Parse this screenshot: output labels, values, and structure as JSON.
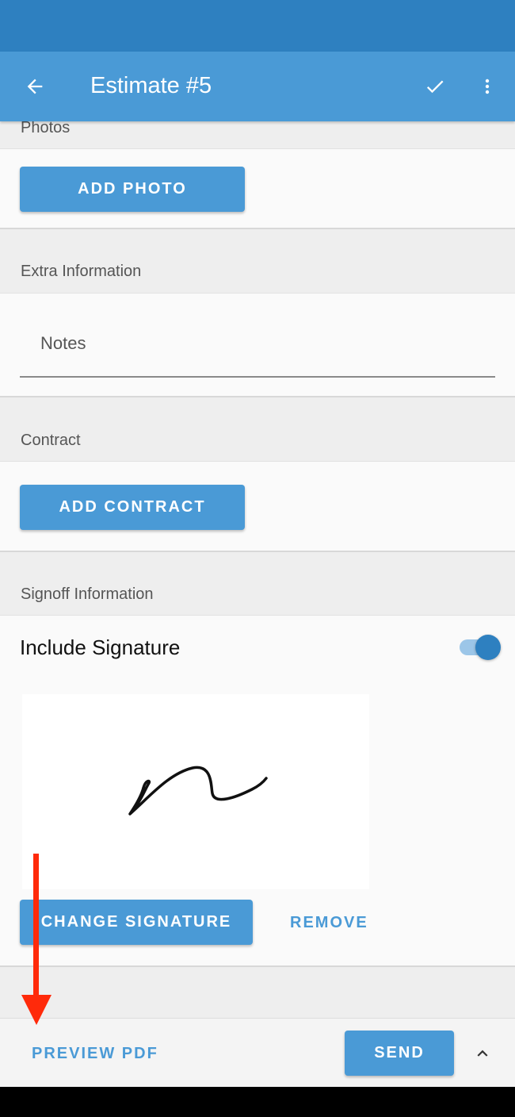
{
  "app_bar": {
    "title": "Estimate #5",
    "back_icon": "arrow-left-icon",
    "confirm_icon": "check-icon",
    "menu_icon": "more-vert-icon"
  },
  "sections": {
    "photos": {
      "header": "Photos",
      "button": "ADD PHOTO"
    },
    "extra": {
      "header": "Extra Information",
      "notes_placeholder": "Notes"
    },
    "contract": {
      "header": "Contract",
      "button": "ADD CONTRACT"
    },
    "signoff": {
      "header": "Signoff Information",
      "include_label": "Include Signature",
      "include_on": true,
      "change_button": "CHANGE SIGNATURE",
      "remove_button": "REMOVE"
    }
  },
  "bottom_bar": {
    "preview": "PREVIEW PDF",
    "send": "SEND",
    "expand_icon": "chevron-up-icon"
  },
  "colors": {
    "accent": "#4a9ad6",
    "status_bar": "#2e80c0",
    "annotation_arrow": "#ff2a0a"
  }
}
